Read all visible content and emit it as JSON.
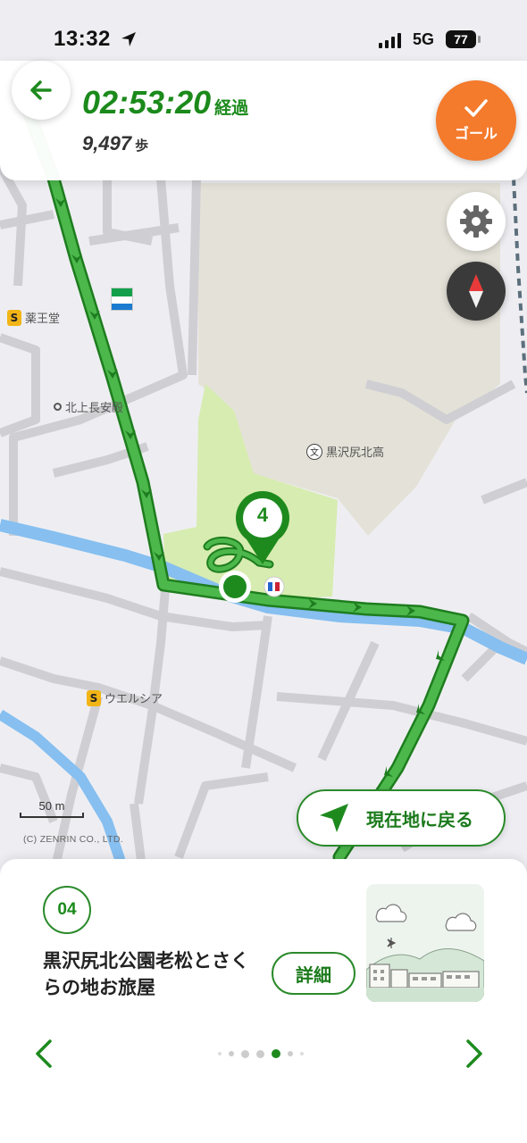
{
  "status": {
    "time": "13:32",
    "network": "5G",
    "battery": "77"
  },
  "header": {
    "elapsed_time": "02:53:20",
    "elapsed_unit": "経過",
    "steps_count": "9,497",
    "steps_unit": "歩",
    "goal_label": "ゴール"
  },
  "map": {
    "labels": {
      "yakuodo": "薬王堂",
      "kitakami": "北上長安殿",
      "school": "黒沢尻北高",
      "welcia": "ウエルシア"
    },
    "school_symbol": "文",
    "checkpoint_number": "4",
    "scale_label": "50 m",
    "copyright": "(C) ZENRIN CO., LTD.",
    "return_button_label": "現在地に戻る",
    "colors": {
      "route": "#4cb84c",
      "route_outline": "#1e7d1e",
      "river": "#86bff0",
      "park": "#d7ecb0",
      "school_ground": "#e4e2d8"
    }
  },
  "spot": {
    "number": "04",
    "name": "黒沢尻北公園老松とさくらの地お旅屋",
    "detail_button": "詳細"
  },
  "pager": {
    "active_index": 3,
    "total": 6
  }
}
